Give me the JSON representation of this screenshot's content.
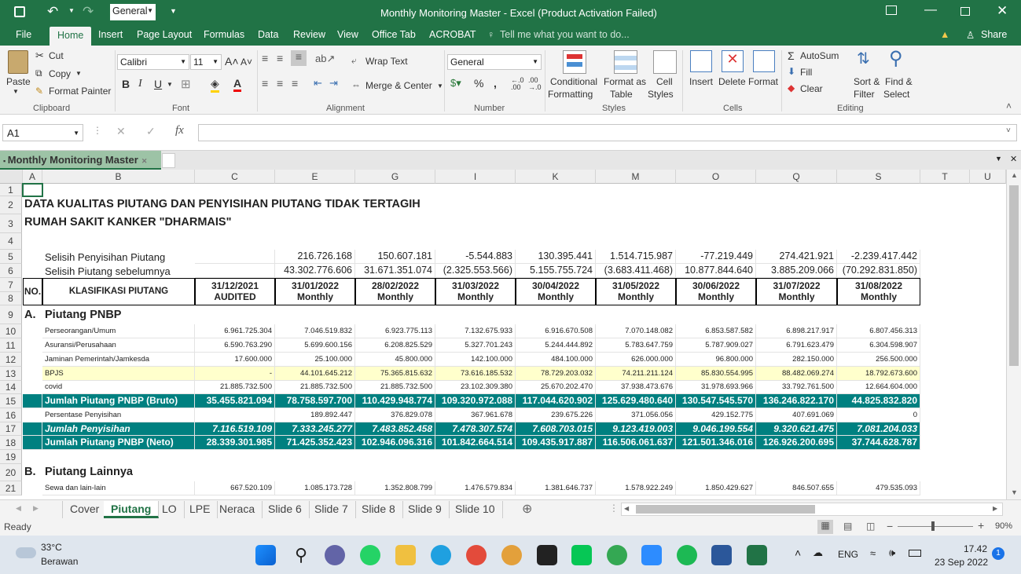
{
  "window": {
    "title": "Monthly Monitoring Master - Excel (Product Activation Failed)",
    "qa_format": "General"
  },
  "ribbon_tabs": [
    "File",
    "Home",
    "Insert",
    "Page Layout",
    "Formulas",
    "Data",
    "Review",
    "View",
    "Office Tab",
    "ACROBAT"
  ],
  "tell_me": "Tell me what you want to do...",
  "share": "Share",
  "clipboard": {
    "paste": "Paste",
    "cut": "Cut",
    "copy": "Copy",
    "format_painter": "Format Painter",
    "group": "Clipboard"
  },
  "font": {
    "name": "Calibri",
    "size": "11",
    "group": "Font"
  },
  "alignment": {
    "wrap": "Wrap Text",
    "merge": "Merge & Center",
    "group": "Alignment"
  },
  "number": {
    "format": "General",
    "group": "Number"
  },
  "styles": {
    "cond": [
      "Conditional",
      "Formatting"
    ],
    "table": [
      "Format as",
      "Table"
    ],
    "cell": [
      "Cell",
      "Styles"
    ],
    "group": "Styles"
  },
  "cells": {
    "insert": "Insert",
    "delete": "Delete",
    "format": "Format",
    "group": "Cells"
  },
  "editing": {
    "autosum": "AutoSum",
    "fill": "Fill",
    "clear": "Clear",
    "sort": [
      "Sort &",
      "Filter"
    ],
    "find": [
      "Find &",
      "Select"
    ],
    "group": "Editing"
  },
  "formula_bar": {
    "name_box": "A1",
    "fx": "fx"
  },
  "workbook_tab": "Monthly Monitoring Master",
  "columns": [
    "A",
    "B",
    "C",
    "E",
    "G",
    "I",
    "K",
    "M",
    "O",
    "Q",
    "S",
    "T",
    "U"
  ],
  "rows": [
    "1",
    "2",
    "3",
    "4",
    "5",
    "6",
    "7",
    "8",
    "9",
    "10",
    "11",
    "12",
    "13",
    "14",
    "15",
    "16",
    "17",
    "18",
    "19",
    "20",
    "21"
  ],
  "sheet": {
    "title1": "DATA KUALITAS PIUTANG DAN PENYISIHAN PIUTANG TIDAK TERTAGIH",
    "title2": "RUMAH SAKIT KANKER \"DHARMAIS\"",
    "r5_label": "Selisih Penyisihan Piutang",
    "r5": [
      "",
      "216.726.168",
      "150.607.181",
      "-5.544.883",
      "130.395.441",
      "1.514.715.987",
      "-77.219.449",
      "274.421.921",
      "-2.239.417.442"
    ],
    "r6_label": "Selisih Piutang sebelumnya",
    "r6": [
      "",
      "43.302.776.606",
      "31.671.351.074",
      "(2.325.553.566)",
      "5.155.755.724",
      "(3.683.411.468)",
      "10.877.844.640",
      "3.885.209.066",
      "(70.292.831.850)"
    ],
    "h_no": "NO.",
    "h_klas": "KLASIFIKASI PIUTANG",
    "h_dates": [
      "31/12/2021",
      "31/01/2022",
      "28/02/2022",
      "31/03/2022",
      "30/04/2022",
      "31/05/2022",
      "30/06/2022",
      "31/07/2022",
      "31/08/2022"
    ],
    "h_sub": [
      "AUDITED",
      "Monthly",
      "Monthly",
      "Monthly",
      "Monthly",
      "Monthly",
      "Monthly",
      "Monthly",
      "Monthly"
    ],
    "secA_no": "A.",
    "secA": "Piutang PNBP",
    "r10_label": "Perseorangan/Umum",
    "r10": [
      "6.961.725.304",
      "7.046.519.832",
      "6.923.775.113",
      "7.132.675.933",
      "6.916.670.508",
      "7.070.148.082",
      "6.853.587.582",
      "6.898.217.917",
      "6.807.456.313"
    ],
    "r11_label": "Asuransi/Perusahaan",
    "r11": [
      "6.590.763.290",
      "5.699.600.156",
      "6.208.825.529",
      "5.327.701.243",
      "5.244.444.892",
      "5.783.647.759",
      "5.787.909.027",
      "6.791.623.479",
      "6.304.598.907"
    ],
    "r12_label": "Jaminan Pemerintah/Jamkesda",
    "r12": [
      "17.600.000",
      "25.100.000",
      "45.800.000",
      "142.100.000",
      "484.100.000",
      "626.000.000",
      "96.800.000",
      "282.150.000",
      "256.500.000"
    ],
    "r13_label": "BPJS",
    "r13": [
      "-",
      "44.101.645.212",
      "75.365.815.632",
      "73.616.185.532",
      "78.729.203.032",
      "74.211.211.124",
      "85.830.554.995",
      "88.482.069.274",
      "18.792.673.600"
    ],
    "r14_label": "covid",
    "r14": [
      "21.885.732.500",
      "21.885.732.500",
      "21.885.732.500",
      "23.102.309.380",
      "25.670.202.470",
      "37.938.473.676",
      "31.978.693.966",
      "33.792.761.500",
      "12.664.604.000"
    ],
    "r15_label": "Jumlah Piutang PNBP (Bruto)",
    "r15": [
      "35.455.821.094",
      "78.758.597.700",
      "110.429.948.774",
      "109.320.972.088",
      "117.044.620.902",
      "125.629.480.640",
      "130.547.545.570",
      "136.246.822.170",
      "44.825.832.820"
    ],
    "r16_label": "Persentase Penyisihan",
    "r16": [
      "",
      "189.892.447",
      "376.829.078",
      "367.961.678",
      "239.675.226",
      "371.056.056",
      "429.152.775",
      "407.691.069",
      "0"
    ],
    "r17_label": "Jumlah Penyisihan",
    "r17": [
      "7.116.519.109",
      "7.333.245.277",
      "7.483.852.458",
      "7.478.307.574",
      "7.608.703.015",
      "9.123.419.003",
      "9.046.199.554",
      "9.320.621.475",
      "7.081.204.033"
    ],
    "r18_label": "Jumlah Piutang PNBP (Neto)",
    "r18": [
      "28.339.301.985",
      "71.425.352.423",
      "102.946.096.316",
      "101.842.664.514",
      "109.435.917.887",
      "116.506.061.637",
      "121.501.346.016",
      "126.926.200.695",
      "37.744.628.787"
    ],
    "secB_no": "B.",
    "secB": "Piutang Lainnya",
    "r21_label": "Sewa dan lain-lain",
    "r21": [
      "667.520.109",
      "1.085.173.728",
      "1.352.808.799",
      "1.476.579.834",
      "1.381.646.737",
      "1.578.922.249",
      "1.850.429.627",
      "846.507.655",
      "479.535.093"
    ]
  },
  "sheet_tabs": [
    "Cover",
    "Piutang",
    "LO",
    "LPE",
    "Neraca",
    "Slide 6",
    "Slide 7",
    "Slide 8",
    "Slide 9",
    "Slide 10"
  ],
  "status": {
    "ready": "Ready",
    "zoom": "90%"
  },
  "taskbar": {
    "temp": "33°C",
    "weather": "Berawan",
    "lang": "ENG",
    "time": "17.42",
    "date": "23 Sep 2022",
    "badge": "1"
  },
  "colors": {
    "excel_green": "#217346",
    "teal": "#008080",
    "yellow": "#ffffcc"
  }
}
